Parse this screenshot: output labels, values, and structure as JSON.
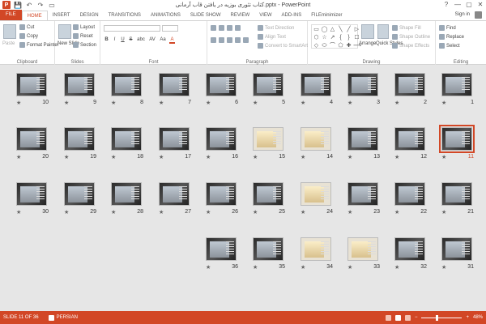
{
  "window": {
    "title": "کتاب تئوری بوزیه در یافتن قاب آرمانی.pptx - PowerPoint",
    "app_icon": "P",
    "help": "?",
    "minimize": "—",
    "maximize": "▢",
    "close": "✕"
  },
  "qat": {
    "save": "💾",
    "undo": "↶",
    "redo": "↷",
    "start": "▭"
  },
  "tabs": [
    {
      "label": "FILE"
    },
    {
      "label": "HOME"
    },
    {
      "label": "INSERT"
    },
    {
      "label": "DESIGN"
    },
    {
      "label": "TRANSITIONS"
    },
    {
      "label": "ANIMATIONS"
    },
    {
      "label": "SLIDE SHOW"
    },
    {
      "label": "REVIEW"
    },
    {
      "label": "VIEW"
    },
    {
      "label": "ADD-INS"
    },
    {
      "label": "FILEminimizer"
    }
  ],
  "account": {
    "signin": "Sign in"
  },
  "ribbon": {
    "clipboard": {
      "label": "Clipboard",
      "paste": "Paste",
      "cut": "Cut",
      "copy": "Copy",
      "format_painter": "Format Painter"
    },
    "slides": {
      "label": "Slides",
      "new_slide": "New Slide",
      "layout": "Layout",
      "reset": "Reset",
      "section": "Section"
    },
    "font": {
      "label": "Font",
      "bold": "B",
      "italic": "I",
      "underline": "U",
      "strike": "S",
      "shadow": "abc",
      "spacing": "AV",
      "case": "Aa",
      "color": "A"
    },
    "paragraph": {
      "label": "Paragraph",
      "text_direction": "Text Direction",
      "align_text": "Align Text",
      "convert": "Convert to SmartArt"
    },
    "drawing": {
      "label": "Drawing",
      "arrange": "Arrange",
      "quick_styles": "Quick Styles",
      "shape_fill": "Shape Fill",
      "shape_outline": "Shape Outline",
      "shape_effects": "Shape Effects",
      "shapes": [
        "▭",
        "◯",
        "△",
        "╲",
        "╱",
        "▷",
        "⬡",
        "☆",
        "↗",
        "{",
        "}",
        "☐",
        "◇",
        "⬭",
        "⌒",
        "⬠",
        "✚",
        "⟶"
      ]
    },
    "editing": {
      "label": "Editing",
      "find": "Find",
      "replace": "Replace",
      "select": "Select"
    }
  },
  "slides": [
    {
      "n": 1,
      "style": "dark"
    },
    {
      "n": 2,
      "style": "dark"
    },
    {
      "n": 3,
      "style": "dark"
    },
    {
      "n": 4,
      "style": "dark"
    },
    {
      "n": 5,
      "style": "dark"
    },
    {
      "n": 6,
      "style": "dark"
    },
    {
      "n": 7,
      "style": "dark"
    },
    {
      "n": 8,
      "style": "dark"
    },
    {
      "n": 9,
      "style": "dark"
    },
    {
      "n": 10,
      "style": "dark"
    },
    {
      "n": 11,
      "style": "dark",
      "selected": true
    },
    {
      "n": 12,
      "style": "dark"
    },
    {
      "n": 13,
      "style": "dark"
    },
    {
      "n": 14,
      "style": "light"
    },
    {
      "n": 15,
      "style": "light"
    },
    {
      "n": 16,
      "style": "dark"
    },
    {
      "n": 17,
      "style": "dark"
    },
    {
      "n": 18,
      "style": "dark"
    },
    {
      "n": 19,
      "style": "dark"
    },
    {
      "n": 20,
      "style": "dark"
    },
    {
      "n": 21,
      "style": "dark"
    },
    {
      "n": 22,
      "style": "dark"
    },
    {
      "n": 23,
      "style": "dark"
    },
    {
      "n": 24,
      "style": "light"
    },
    {
      "n": 25,
      "style": "dark"
    },
    {
      "n": 26,
      "style": "dark"
    },
    {
      "n": 27,
      "style": "dark"
    },
    {
      "n": 28,
      "style": "dark"
    },
    {
      "n": 29,
      "style": "dark"
    },
    {
      "n": 30,
      "style": "dark"
    },
    {
      "n": 31,
      "style": "dark"
    },
    {
      "n": 32,
      "style": "dark"
    },
    {
      "n": 33,
      "style": "light"
    },
    {
      "n": 34,
      "style": "light"
    },
    {
      "n": 35,
      "style": "dark"
    },
    {
      "n": 36,
      "style": "dark"
    }
  ],
  "slide_star": "★",
  "status": {
    "slide_info": "SLIDE 11 OF 36",
    "language": "PERSIAN",
    "zoom": "48%",
    "zoom_out": "−",
    "zoom_in": "+"
  },
  "colors": {
    "accent": "#d24726",
    "sorter_bg": "#e6e6e6"
  }
}
